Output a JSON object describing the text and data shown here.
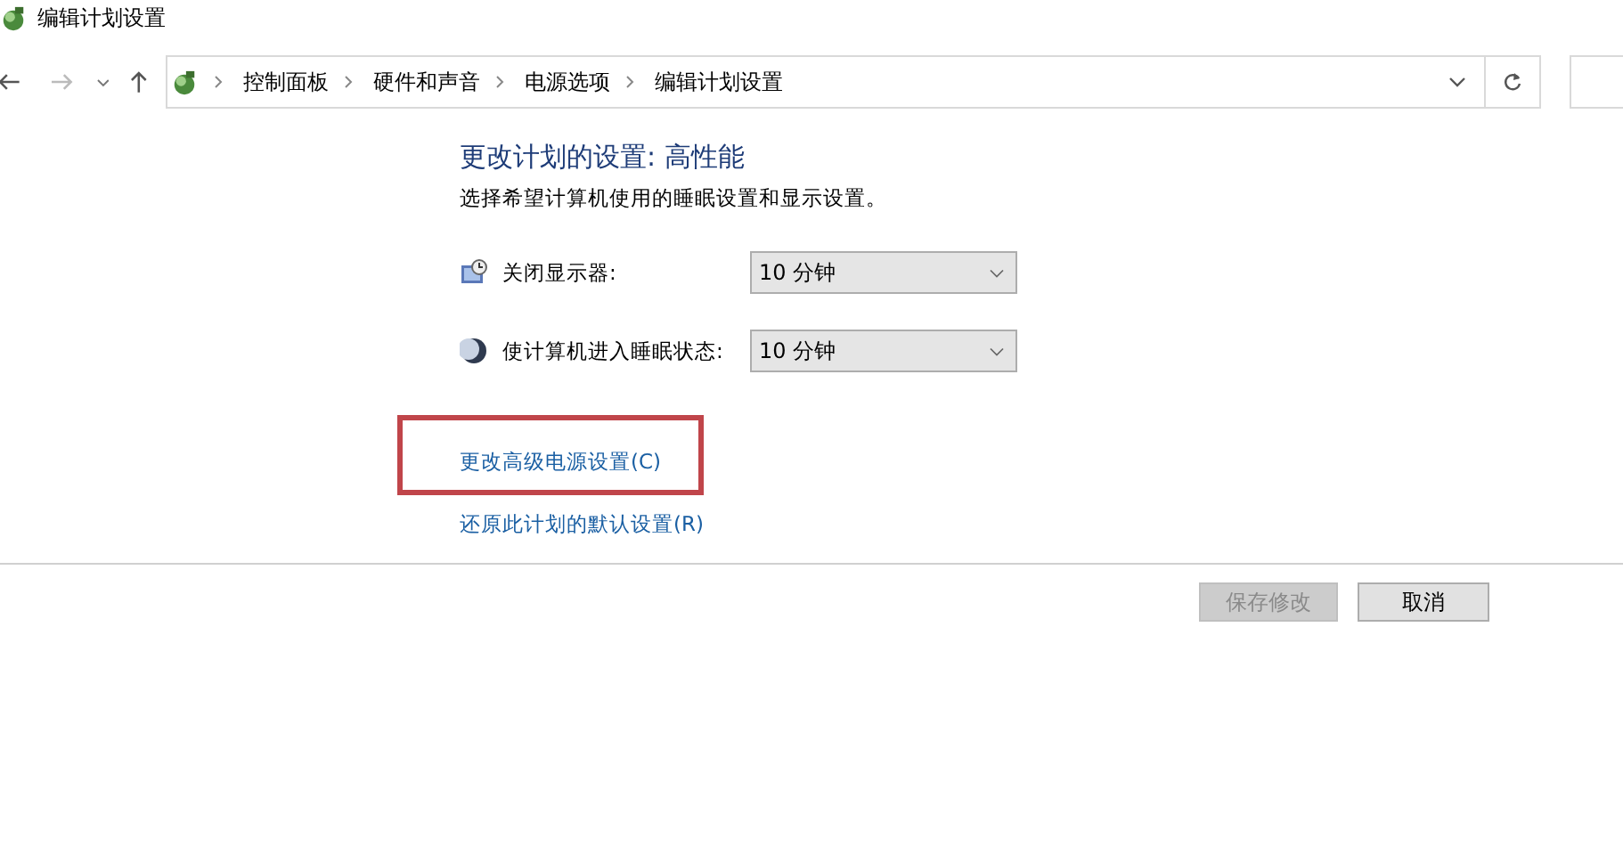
{
  "window": {
    "title": "编辑计划设置"
  },
  "address_bar": {
    "breadcrumbs": [
      "控制面板",
      "硬件和声音",
      "电源选项",
      "编辑计划设置"
    ]
  },
  "heading": "更改计划的设置: 高性能",
  "subtitle": "选择希望计算机使用的睡眠设置和显示设置。",
  "settings": [
    {
      "kind": "display",
      "label": "关闭显示器:",
      "value": "10 分钟"
    },
    {
      "kind": "sleep",
      "label": "使计算机进入睡眠状态:",
      "value": "10 分钟"
    }
  ],
  "links": [
    {
      "text": "更改高级电源设置(C)",
      "highlighted": true
    },
    {
      "text": "还原此计划的默认设置(R)",
      "highlighted": false
    }
  ],
  "buttons": [
    {
      "label": "保存修改",
      "disabled": true
    },
    {
      "label": "取消",
      "disabled": false
    }
  ]
}
